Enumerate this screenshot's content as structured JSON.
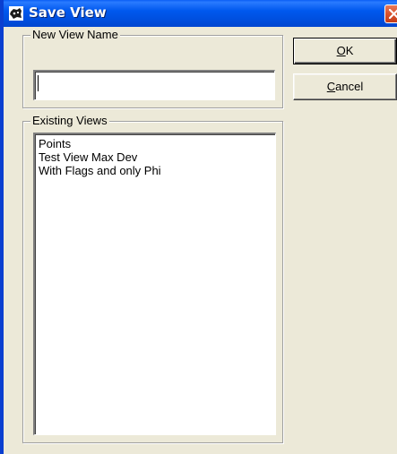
{
  "window": {
    "title": "Save View",
    "icon": "save-view-app-icon",
    "close_icon": "close-icon"
  },
  "new_view": {
    "group_label": "New View Name",
    "name_value": "",
    "name_placeholder": ""
  },
  "existing_views": {
    "group_label": "Existing Views",
    "items": [
      "Points",
      "Test View Max Dev",
      "With Flags and only Phi"
    ]
  },
  "buttons": {
    "ok": {
      "accel": "O",
      "rest": "K"
    },
    "cancel": {
      "accel": "C",
      "rest": "ancel"
    }
  },
  "colors": {
    "titlebar": "#0058ee",
    "dialog_bg": "#ece9d8",
    "close_button": "#d9522c"
  }
}
